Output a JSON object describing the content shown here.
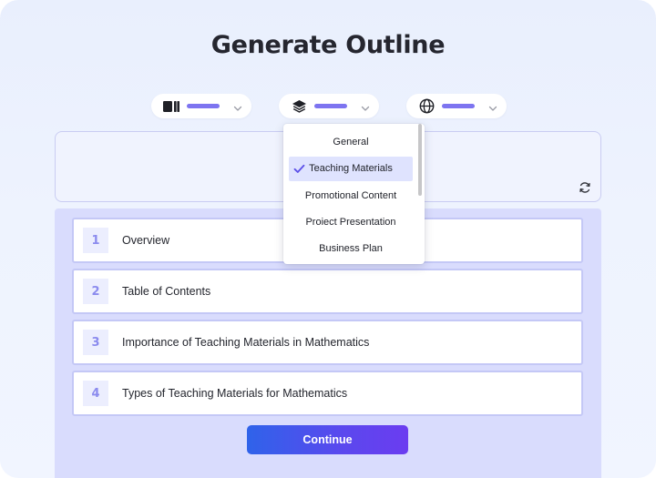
{
  "page": {
    "title": "Generate Outline"
  },
  "toolbar": {
    "pills": [
      {
        "icon": "presentation-icon"
      },
      {
        "icon": "layers-icon"
      },
      {
        "icon": "globe-icon"
      }
    ],
    "accent": "#7d74f0"
  },
  "prompt": {
    "value": ""
  },
  "dropdown": {
    "items": [
      {
        "label": "General",
        "selected": false
      },
      {
        "label": "Teaching Materials",
        "selected": true
      },
      {
        "label": "Promotional Content",
        "selected": false
      },
      {
        "label": "Proiect Presentation",
        "selected": false
      },
      {
        "label": "Business Plan",
        "selected": false
      }
    ]
  },
  "outline": {
    "rows": [
      {
        "num": "1",
        "text": "Overview"
      },
      {
        "num": "2",
        "text": "Table of Contents"
      },
      {
        "num": "3",
        "text": "Importance of Teaching Materials in Mathematics"
      },
      {
        "num": "4",
        "text": "Types of Teaching Materials for Mathematics"
      }
    ]
  },
  "actions": {
    "continue_label": "Continue"
  },
  "colors": {
    "panel": "#d9dcfd",
    "row_border": "#c4c8f6",
    "selected_bg": "#dfe3fe",
    "check": "#5b4fe8",
    "button_start": "#2f63ea",
    "button_end": "#6b3cf0"
  }
}
